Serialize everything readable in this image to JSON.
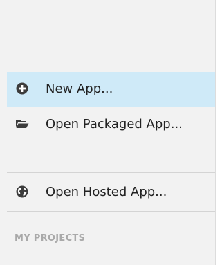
{
  "menu": {
    "new_app": {
      "label": "New App...",
      "icon": "plus-circle-icon"
    },
    "open_packaged": {
      "label": "Open Packaged App...",
      "icon": "folder-open-icon"
    },
    "open_hosted": {
      "label": "Open Hosted App...",
      "icon": "globe-icon"
    }
  },
  "sections": {
    "my_projects": "MY PROJECTS"
  },
  "colors": {
    "panel_bg": "#f2f2f2",
    "selected_bg": "#cfeaf8",
    "icon": "#3c3c3c",
    "section_header": "#a9a9a9"
  }
}
